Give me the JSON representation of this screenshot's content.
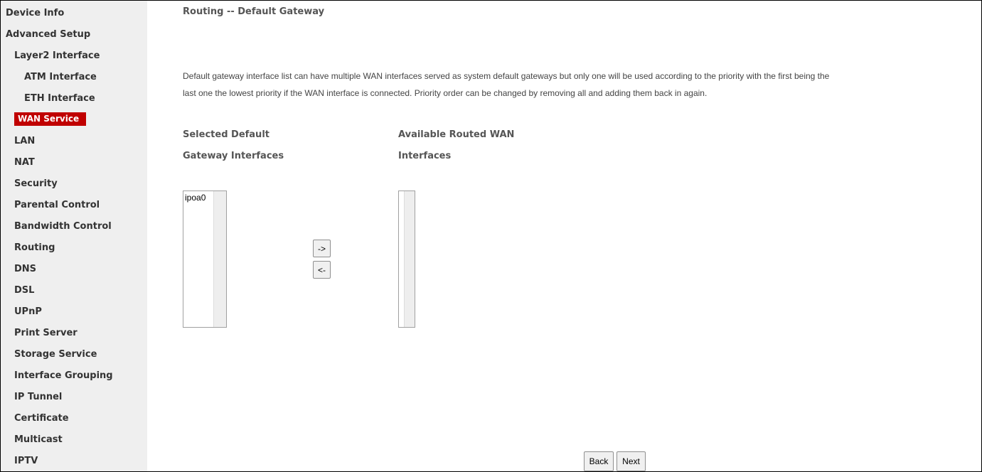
{
  "sidebar": {
    "items": [
      {
        "label": "Device Info"
      },
      {
        "label": "Advanced Setup"
      },
      {
        "label": "Layer2 Interface"
      },
      {
        "label": "ATM Interface"
      },
      {
        "label": "ETH Interface"
      },
      {
        "label": "WAN Service",
        "active": true
      },
      {
        "label": "LAN"
      },
      {
        "label": "NAT"
      },
      {
        "label": "Security"
      },
      {
        "label": "Parental Control"
      },
      {
        "label": "Bandwidth Control"
      },
      {
        "label": "Routing"
      },
      {
        "label": "DNS"
      },
      {
        "label": "DSL"
      },
      {
        "label": "UPnP"
      },
      {
        "label": "Print Server"
      },
      {
        "label": "Storage Service"
      },
      {
        "label": "Interface Grouping"
      },
      {
        "label": "IP Tunnel"
      },
      {
        "label": "Certificate"
      },
      {
        "label": "Multicast"
      },
      {
        "label": "IPTV"
      }
    ]
  },
  "main": {
    "title": "Routing -- Default Gateway",
    "description_line1": "Default gateway interface list can have multiple WAN interfaces served as system default gateways but only one will be used according to the priority with the first being the",
    "description_line2": "last one the lowest priority if the WAN interface is connected. Priority order can be changed by removing all and adding them back in again.",
    "selected": {
      "header_line1": "Selected Default",
      "header_line2": "Gateway Interfaces",
      "items": [
        "ipoa0"
      ]
    },
    "available": {
      "header_line1": "Available Routed WAN",
      "header_line2": "Interfaces",
      "items": []
    },
    "move_right_label": "->",
    "move_left_label": "<-",
    "back_label": "Back",
    "next_label": "Next"
  },
  "colors": {
    "sidebar_bg": "#efefef",
    "active_bg": "#c00000",
    "text": "#333333"
  }
}
